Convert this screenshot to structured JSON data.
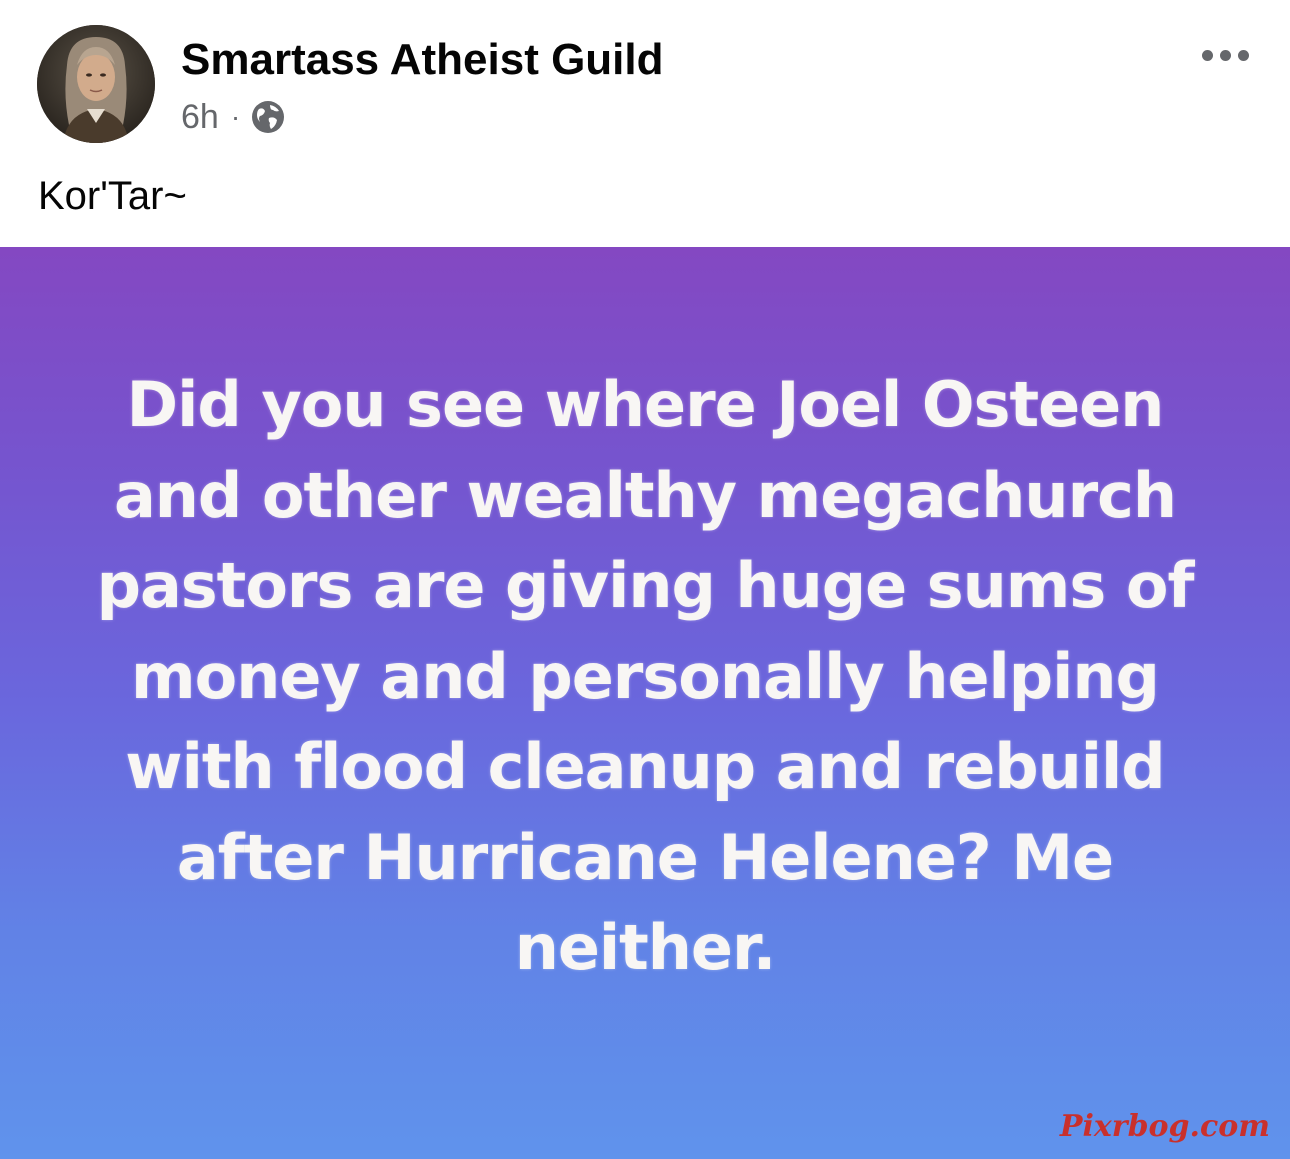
{
  "post": {
    "author": "Smartass Atheist Guild",
    "timestamp": "6h",
    "separator": "·",
    "audience_icon": "globe-icon",
    "menu_icon": "more-options-icon",
    "caption": "Kor'Tar~",
    "image": {
      "quote": "Did you see where Joel Osteen and other wealthy megachurch pastors are giving huge sums of money and personally helping with flood cleanup and rebuild after Hurricane Helene? Me neither.",
      "watermark": "Pixrbog.com",
      "gradient_top": "#8448c2",
      "gradient_bottom": "#6093ec"
    }
  }
}
